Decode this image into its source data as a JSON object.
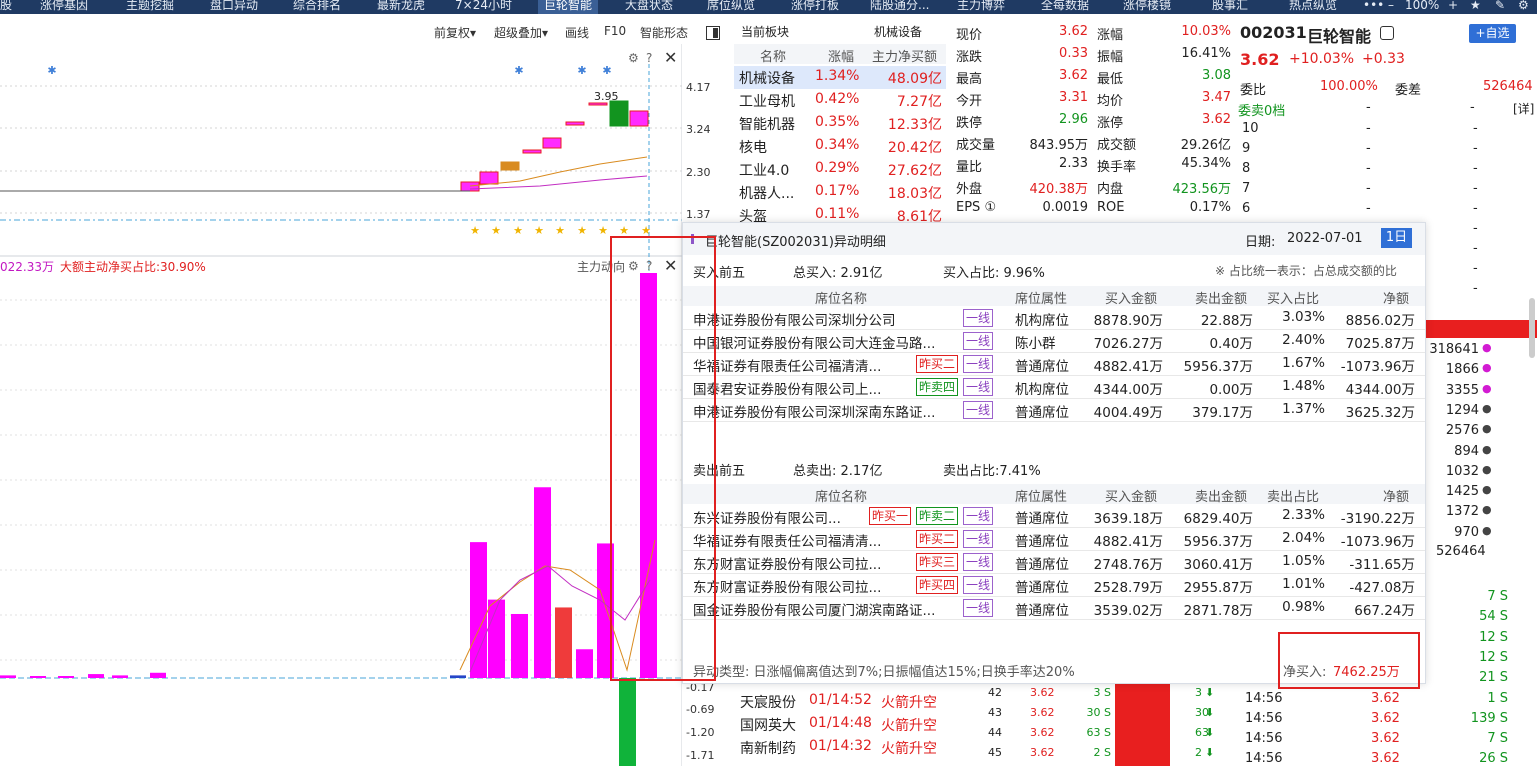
{
  "nav": {
    "tabs": [
      "股",
      "涨停基因",
      "主题挖掘",
      "盘口异动",
      "综合排名",
      "最新龙虎",
      "7×24小时",
      "巨轮智能",
      "大盘状态",
      "席位纵览",
      "涨停打板",
      "陆股通分...",
      "主力博弈",
      "全每数据",
      "涨停楼镜",
      "股事汇",
      "热点纵览"
    ],
    "zoom": "100%",
    "more": "•••",
    "minus": "–",
    "plus": "+"
  },
  "chart_toolbar": {
    "adjust": "前复权",
    "overlay": "超级叠加",
    "draw": "画线",
    "f10": "F10",
    "smart": "智能形态"
  },
  "kline_axis": [
    "4.17",
    "3.24",
    "2.30",
    "1.37"
  ],
  "kline_high_label": "3.95",
  "lower_axis": [
    "-0.17",
    "-0.69",
    "-1.20",
    "-1.71"
  ],
  "lower_header": {
    "left": "022.33万",
    "ratio": "大额主动净买占比:30.90%",
    "right": "主力动向"
  },
  "sector": {
    "title": "当前板块",
    "current": "机械设备",
    "headers": [
      "名称",
      "涨幅",
      "主力净买额"
    ],
    "rows": [
      {
        "name": "机械设备",
        "chg": "1.34%",
        "net": "48.09亿"
      },
      {
        "name": "工业母机",
        "chg": "0.42%",
        "net": "7.27亿"
      },
      {
        "name": "智能机器",
        "chg": "0.35%",
        "net": "12.33亿"
      },
      {
        "name": "核电",
        "chg": "0.34%",
        "net": "20.42亿"
      },
      {
        "name": "工业4.0",
        "chg": "0.29%",
        "net": "27.62亿"
      },
      {
        "name": "机器人...",
        "chg": "0.17%",
        "net": "18.03亿"
      },
      {
        "name": "头盔",
        "chg": "0.11%",
        "net": "8.61亿"
      }
    ]
  },
  "quote": {
    "rows": [
      {
        "l1": "现价",
        "v1": "3.62",
        "l2": "涨幅",
        "v2": "10.03%"
      },
      {
        "l1": "涨跌",
        "v1": "0.33",
        "l2": "振幅",
        "v2": "16.41%"
      },
      {
        "l1": "最高",
        "v1": "3.62",
        "l2": "最低",
        "v2": "3.08"
      },
      {
        "l1": "今开",
        "v1": "3.31",
        "l2": "均价",
        "v2": "3.47"
      },
      {
        "l1": "跌停",
        "v1": "2.96",
        "l2": "涨停",
        "v2": "3.62"
      },
      {
        "l1": "成交量",
        "v1": "843.95万",
        "l2": "成交额",
        "v2": "29.26亿"
      },
      {
        "l1": "量比",
        "v1": "2.33",
        "l2": "换手率",
        "v2": "45.34%"
      },
      {
        "l1": "外盘",
        "v1": "420.38万",
        "l2": "内盘",
        "v2": "423.56万"
      },
      {
        "l1": "EPS ①",
        "v1": "0.0019",
        "l2": "ROE",
        "v2": "0.17%"
      }
    ]
  },
  "stock": {
    "code": "002031",
    "name": "巨轮智能",
    "price": "3.62",
    "pct": "+10.03%",
    "chg": "+0.33",
    "add_btn": "+自选",
    "weibi_label": "委比",
    "weibi": "100.00%",
    "weicha_label": "委差",
    "weicha": "526464",
    "sell_label": "委卖0档",
    "detail": "[详]",
    "ask_levels": [
      "10",
      "9",
      "8",
      "7",
      "6"
    ],
    "dash": "-",
    "bid_vols": [
      "318641",
      "1866",
      "3355",
      "1294",
      "2576",
      "894",
      "1032",
      "1425",
      "1372",
      "970"
    ],
    "bid_total": "526464",
    "bracket": "]"
  },
  "popup": {
    "title": "巨轮智能(SZ002031)异动明细",
    "date_label": "日期:",
    "date": "2022-07-01",
    "period": "1日",
    "buy_title": "买入前五",
    "buy_total": "总买入: 2.91亿",
    "buy_ratio": "买入占比: 9.96%",
    "note": "※ 占比统一表示：占总成交额的比",
    "headers": [
      "席位名称",
      "席位属性",
      "买入金额",
      "卖出金额",
      "买入占比",
      "净额"
    ],
    "sell_headers": [
      "席位名称",
      "席位属性",
      "买入金额",
      "卖出金额",
      "卖出占比",
      "净额"
    ],
    "buy_rows": [
      {
        "name": "申港证券股份有限公司深圳分公司",
        "tags": [
          {
            "t": "一线",
            "c": "purple"
          }
        ],
        "attr": "机构席位",
        "buy": "8878.90万",
        "sell": "22.88万",
        "ratio": "3.03%",
        "net": "8856.02万"
      },
      {
        "name": "中国银河证券股份有限公司大连金马路...",
        "tags": [
          {
            "t": "一线",
            "c": "purple"
          }
        ],
        "attr": "陈小群",
        "buy": "7026.27万",
        "sell": "0.40万",
        "ratio": "2.40%",
        "net": "7025.87万"
      },
      {
        "name": "华福证券有限责任公司福清清...",
        "tags": [
          {
            "t": "昨买二",
            "c": "red"
          },
          {
            "t": "一线",
            "c": "purple"
          }
        ],
        "attr": "普通席位",
        "buy": "4882.41万",
        "sell": "5956.37万",
        "ratio": "1.67%",
        "net": "-1073.96万"
      },
      {
        "name": "国泰君安证券股份有限公司上...",
        "tags": [
          {
            "t": "昨卖四",
            "c": "green"
          },
          {
            "t": "一线",
            "c": "purple"
          }
        ],
        "attr": "机构席位",
        "buy": "4344.00万",
        "sell": "0.00万",
        "ratio": "1.48%",
        "net": "4344.00万"
      },
      {
        "name": "申港证券股份有限公司深圳深南东路证...",
        "tags": [
          {
            "t": "一线",
            "c": "purple"
          }
        ],
        "attr": "普通席位",
        "buy": "4004.49万",
        "sell": "379.17万",
        "ratio": "1.37%",
        "net": "3625.32万"
      }
    ],
    "sell_title": "卖出前五",
    "sell_total": "总卖出: 2.17亿",
    "sell_ratio": "卖出占比:7.41%",
    "sell_rows": [
      {
        "name": "东兴证券股份有限公司...",
        "tags": [
          {
            "t": "昨买一",
            "c": "red"
          },
          {
            "t": "昨卖二",
            "c": "green"
          },
          {
            "t": "一线",
            "c": "purple"
          }
        ],
        "attr": "普通席位",
        "buy": "3639.18万",
        "sell": "6829.40万",
        "ratio": "2.33%",
        "net": "-3190.22万"
      },
      {
        "name": "华福证券有限责任公司福清清...",
        "tags": [
          {
            "t": "昨买二",
            "c": "red"
          },
          {
            "t": "一线",
            "c": "purple"
          }
        ],
        "attr": "普通席位",
        "buy": "4882.41万",
        "sell": "5956.37万",
        "ratio": "2.04%",
        "net": "-1073.96万"
      },
      {
        "name": "东方财富证券股份有限公司拉...",
        "tags": [
          {
            "t": "昨买三",
            "c": "red"
          },
          {
            "t": "一线",
            "c": "purple"
          }
        ],
        "attr": "普通席位",
        "buy": "2748.76万",
        "sell": "3060.41万",
        "ratio": "1.05%",
        "net": "-311.65万"
      },
      {
        "name": "东方财富证券股份有限公司拉...",
        "tags": [
          {
            "t": "昨买四",
            "c": "red"
          },
          {
            "t": "一线",
            "c": "purple"
          }
        ],
        "attr": "普通席位",
        "buy": "2528.79万",
        "sell": "2955.87万",
        "ratio": "1.01%",
        "net": "-427.08万"
      },
      {
        "name": "国金证券股份有限公司厦门湖滨南路证...",
        "tags": [
          {
            "t": "一线",
            "c": "purple"
          }
        ],
        "attr": "普通席位",
        "buy": "3539.02万",
        "sell": "2871.78万",
        "ratio": "0.98%",
        "net": "667.24万"
      }
    ],
    "footer_type": "异动类型: 日涨幅偏离值达到7%;日振幅值达15%;日换手率达20%",
    "net_buy_label": "净买入:",
    "net_buy": "7462.25万"
  },
  "rocket": [
    {
      "name": "天宸股份",
      "time": "01/14:52",
      "tag": "火箭升空"
    },
    {
      "name": "国网英大",
      "time": "01/14:48",
      "tag": "火箭升空"
    },
    {
      "name": "南新制药",
      "time": "01/14:32",
      "tag": "火箭升空"
    }
  ],
  "queue": [
    {
      "n": "42",
      "p": "3.62",
      "v": "3 S",
      "q": "3"
    },
    {
      "n": "43",
      "p": "3.62",
      "v": "30 S",
      "q": "30"
    },
    {
      "n": "44",
      "p": "3.62",
      "v": "63 S",
      "q": "63"
    },
    {
      "n": "45",
      "p": "3.62",
      "v": "2 S",
      "q": "2"
    }
  ],
  "ticks": [
    {
      "t": "",
      "p": "",
      "v": "7 S"
    },
    {
      "t": "",
      "p": "",
      "v": "54 S"
    },
    {
      "t": "",
      "p": "",
      "v": "12 S"
    },
    {
      "t": "",
      "p": "",
      "v": "12 S"
    },
    {
      "t": "",
      "p": "",
      "v": "21 S"
    },
    {
      "t": "14:56",
      "p": "3.62",
      "v": "1 S"
    },
    {
      "t": "14:56",
      "p": "3.62",
      "v": "139 S"
    },
    {
      "t": "14:56",
      "p": "3.62",
      "v": "7 S"
    },
    {
      "t": "14:56",
      "p": "3.62",
      "v": "26 S"
    }
  ],
  "lower_bars": [
    {
      "v": 0.2,
      "c": "magenta"
    },
    {
      "v": 0.0,
      "c": "magenta"
    },
    {
      "v": 0.1,
      "c": "magenta"
    },
    {
      "v": 0.3,
      "c": "magenta"
    },
    {
      "v": 0.2,
      "c": "magenta"
    },
    {
      "v": 0.4,
      "c": "magenta"
    },
    {
      "v": 0.2,
      "c": "blue"
    },
    {
      "v": 10.4,
      "c": "magenta"
    },
    {
      "v": 6.0,
      "c": "magenta"
    },
    {
      "v": 4.9,
      "c": "magenta"
    },
    {
      "v": 14.6,
      "c": "magenta"
    },
    {
      "v": 5.4,
      "c": "red"
    },
    {
      "v": 2.2,
      "c": "magenta"
    },
    {
      "v": 10.3,
      "c": "magenta"
    },
    {
      "v": 31.0,
      "c": "magenta"
    }
  ]
}
